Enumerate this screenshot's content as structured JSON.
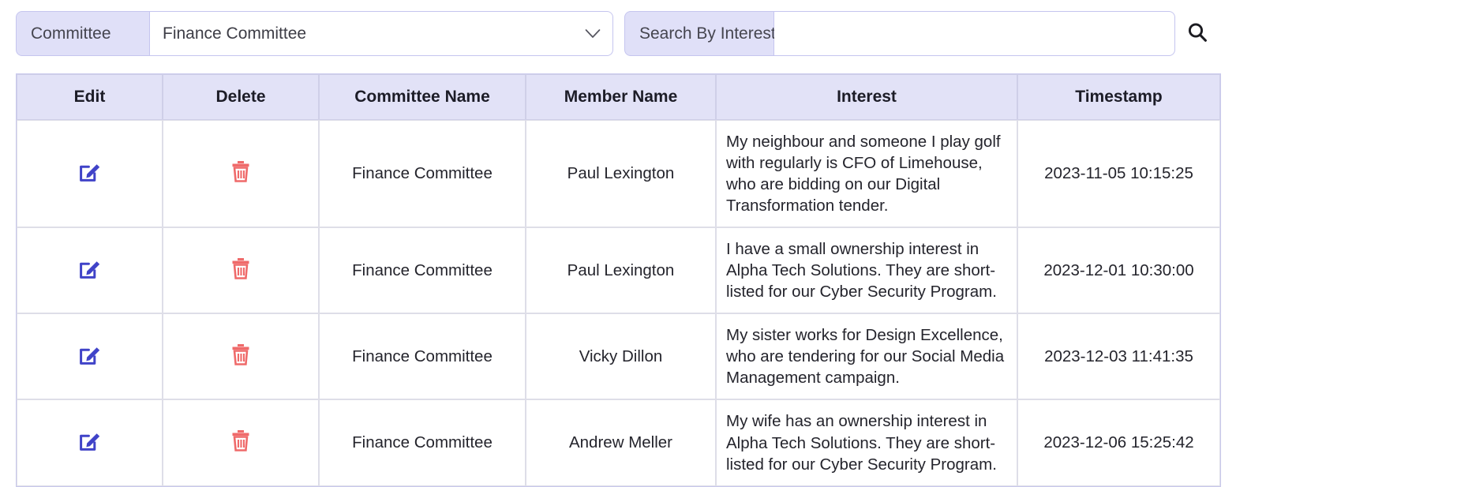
{
  "filters": {
    "committee": {
      "label": "Committee",
      "selected": "Finance Committee",
      "options": [
        "Finance Committee"
      ],
      "chevron_icon": "chevron-down-icon"
    },
    "search": {
      "label": "Search By Interest",
      "value": "",
      "placeholder": "",
      "button_icon": "search-icon"
    }
  },
  "table": {
    "columns": [
      "Edit",
      "Delete",
      "Committee Name",
      "Member Name",
      "Interest",
      "Timestamp"
    ],
    "row_icons": {
      "edit": "edit-pencil-square-icon",
      "delete": "trash-can-icon"
    },
    "rows": [
      {
        "committee_name": "Finance Committee",
        "member_name": "Paul Lexington",
        "interest": "My neighbour and someone I play golf with regularly is CFO of Limehouse, who are bidding on our Digital Transformation tender.",
        "timestamp": "2023-11-05 10:15:25"
      },
      {
        "committee_name": "Finance Committee",
        "member_name": "Paul Lexington",
        "interest": "I have a small ownership interest in Alpha Tech Solutions. They are short-listed for our Cyber Security Program.",
        "timestamp": "2023-12-01 10:30:00"
      },
      {
        "committee_name": "Finance Committee",
        "member_name": "Vicky Dillon",
        "interest": "My sister works for Design Excellence, who are tendering for our Social Media Management campaign.",
        "timestamp": "2023-12-03 11:41:35"
      },
      {
        "committee_name": "Finance Committee",
        "member_name": "Andrew Meller",
        "interest": "My wife has an ownership interest in Alpha Tech Solutions. They are short-listed for our Cyber Security Program.",
        "timestamp": "2023-12-06 15:25:42"
      }
    ]
  },
  "colors": {
    "accent_lavender": "#e0e0f8",
    "border_lavender": "#c5c5ef",
    "header_bg": "#e2e2f7",
    "edit_icon": "#4043c8",
    "delete_icon": "#ef6a6a",
    "text": "#24242c"
  }
}
